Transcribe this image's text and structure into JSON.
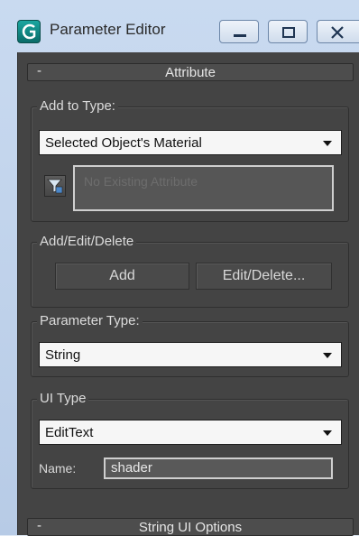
{
  "window": {
    "title": "Parameter Editor",
    "buttons": {
      "minimize": "minimize-icon",
      "maximize": "maximize-icon",
      "close": "close-icon"
    }
  },
  "attribute_rollout": {
    "collapse_symbol": "-",
    "title": "Attribute",
    "add_to_type": {
      "title": "Add to Type:",
      "selected": "Selected Object's Material",
      "filter_icon": "filter-icon",
      "listbox_placeholder": "No Existing Attribute"
    },
    "add_edit_delete": {
      "title": "Add/Edit/Delete",
      "add_label": "Add",
      "edit_delete_label": "Edit/Delete..."
    },
    "parameter_type": {
      "title": "Parameter Type:",
      "selected": "String"
    },
    "ui_type": {
      "title": "UI Type",
      "selected": "EditText",
      "name_label": "Name:",
      "name_value": "shader"
    }
  },
  "string_ui_rollout": {
    "collapse_symbol": "-",
    "title": "String UI Options"
  }
}
